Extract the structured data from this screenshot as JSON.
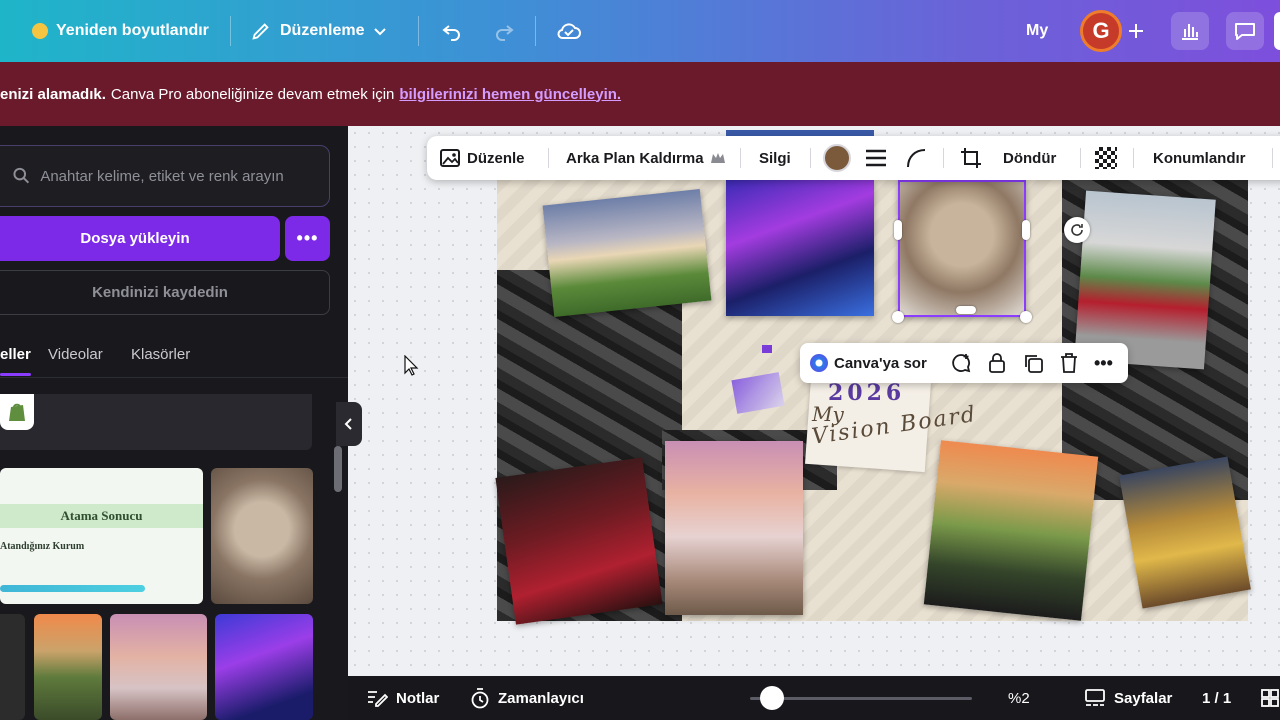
{
  "topbar": {
    "resize_label": "Yeniden boyutlandır",
    "edit_label": "Düzenleme",
    "my_label": "My",
    "avatar_letter": "G",
    "gradient_start": "#1fb5c9",
    "gradient_end": "#7d4fdc"
  },
  "banner": {
    "bold_text": "enizi alamadık.",
    "text": "Canva Pro aboneliğinize devam etmek için",
    "link_text": "bilgilerinizi hemen güncelleyin.",
    "background": "#6b1a2c"
  },
  "left_panel": {
    "search_placeholder": "Anahtar kelime, etiket ve renk arayın",
    "upload_label": "Dosya yükleyin",
    "more_label": "•••",
    "record_label": "Kendinizi kaydedin",
    "tabs": [
      {
        "label": "eller",
        "active": true
      },
      {
        "label": "Videolar",
        "active": false
      },
      {
        "label": "Klasörler",
        "active": false
      }
    ],
    "result_card": {
      "title": "Atama Sonucu",
      "subtitle": "Atandığınız Kurum"
    },
    "accent": "#7d2ae8"
  },
  "toolbar": {
    "edit_label": "Düzenle",
    "bg_remove_label": "Arka Plan Kaldırma",
    "eraser_label": "Silgi",
    "rotate_label": "Döndür",
    "position_label": "Konumlandır",
    "color_swatch": "#7b5a3c"
  },
  "ask_bar": {
    "label": "Canva'ya sor"
  },
  "board": {
    "handwriting_line1": "My",
    "handwriting_line2": "Vision Board",
    "year_text": "2026"
  },
  "bottombar": {
    "notes_label": "Notlar",
    "timer_label": "Zamanlayıcı",
    "zoom_label": "%2",
    "pages_label": "Sayfalar",
    "page_count": "1 / 1",
    "zoom_fraction": 0.1
  }
}
